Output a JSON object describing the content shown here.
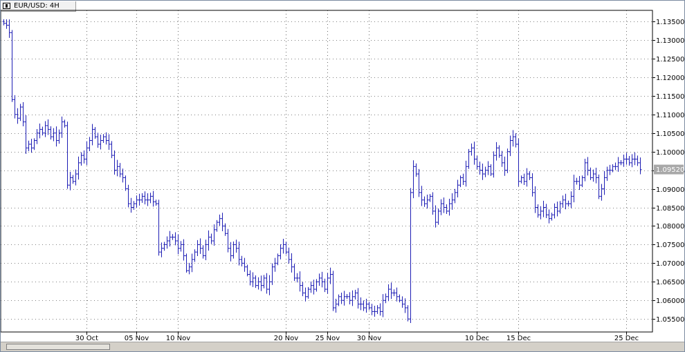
{
  "window": {
    "title": "EUR/USD: 4H"
  },
  "chart_data": {
    "type": "ohlc",
    "symbol": "EUR/USD",
    "timeframe": "4H",
    "current_price_label": "1.09520",
    "bar_color": "#1c1cb4",
    "grid": "dotted",
    "ylim": [
      1.0515,
      1.138
    ],
    "y_ticks": [
      "1.13500",
      "1.13000",
      "1.12500",
      "1.12000",
      "1.11500",
      "1.11000",
      "1.10500",
      "1.10000",
      "1.09500",
      "1.09000",
      "1.08500",
      "1.08000",
      "1.07500",
      "1.07000",
      "1.06500",
      "1.06000",
      "1.05500"
    ],
    "x_ticks": [
      {
        "label": "30 Oct",
        "bar": 30
      },
      {
        "label": "05 Nov",
        "bar": 48
      },
      {
        "label": "10 Nov",
        "bar": 63
      },
      {
        "label": "20 Nov",
        "bar": 102
      },
      {
        "label": "25 Nov",
        "bar": 117
      },
      {
        "label": "30 Nov",
        "bar": 132
      },
      {
        "label": "10 Dec",
        "bar": 171
      },
      {
        "label": "15 Dec",
        "bar": 186
      },
      {
        "label": "25 Dec",
        "bar": 225
      }
    ],
    "closes": [
      1.1345,
      1.134,
      1.132,
      1.114,
      1.11,
      1.109,
      1.112,
      1.108,
      1.101,
      1.102,
      1.101,
      1.103,
      1.105,
      1.106,
      1.105,
      1.107,
      1.106,
      1.104,
      1.105,
      1.103,
      1.105,
      1.108,
      1.107,
      1.091,
      1.093,
      1.092,
      1.094,
      1.097,
      1.099,
      1.098,
      1.101,
      1.103,
      1.106,
      1.104,
      1.102,
      1.103,
      1.104,
      1.103,
      1.102,
      1.099,
      1.095,
      1.096,
      1.094,
      1.093,
      1.09,
      1.086,
      1.085,
      1.086,
      1.087,
      1.087,
      1.088,
      1.087,
      1.087,
      1.088,
      1.0865,
      1.086,
      1.073,
      1.074,
      1.075,
      1.076,
      1.077,
      1.077,
      1.076,
      1.074,
      1.075,
      1.072,
      1.068,
      1.069,
      1.071,
      1.073,
      1.075,
      1.074,
      1.072,
      1.075,
      1.077,
      1.076,
      1.079,
      1.081,
      1.082,
      1.08,
      1.078,
      1.074,
      1.072,
      1.075,
      1.074,
      1.071,
      1.07,
      1.069,
      1.067,
      1.065,
      1.066,
      1.064,
      1.065,
      1.064,
      1.066,
      1.063,
      1.065,
      1.069,
      1.07,
      1.072,
      1.074,
      1.075,
      1.073,
      1.071,
      1.069,
      1.066,
      1.066,
      1.064,
      1.062,
      1.061,
      1.063,
      1.064,
      1.063,
      1.065,
      1.066,
      1.065,
      1.063,
      1.066,
      1.067,
      1.058,
      1.059,
      1.061,
      1.06,
      1.061,
      1.061,
      1.06,
      1.061,
      1.062,
      1.059,
      1.059,
      1.058,
      1.059,
      1.058,
      1.057,
      1.057,
      1.058,
      1.057,
      1.06,
      1.061,
      1.063,
      1.062,
      1.062,
      1.061,
      1.06,
      1.059,
      1.058,
      1.055,
      1.089,
      1.096,
      1.094,
      1.089,
      1.087,
      1.086,
      1.087,
      1.088,
      1.084,
      1.081,
      1.084,
      1.086,
      1.085,
      1.084,
      1.086,
      1.087,
      1.089,
      1.091,
      1.093,
      1.092,
      1.096,
      1.1,
      1.101,
      1.098,
      1.096,
      1.095,
      1.094,
      1.095,
      1.096,
      1.094,
      1.099,
      1.101,
      1.099,
      1.097,
      1.095,
      1.1,
      1.103,
      1.104,
      1.102,
      1.092,
      1.093,
      1.092,
      1.094,
      1.093,
      1.089,
      1.085,
      1.083,
      1.084,
      1.085,
      1.083,
      1.082,
      1.083,
      1.085,
      1.084,
      1.086,
      1.087,
      1.086,
      1.086,
      1.088,
      1.092,
      1.092,
      1.091,
      1.093,
      1.097,
      1.095,
      1.093,
      1.094,
      1.093,
      1.088,
      1.09,
      1.093,
      1.095,
      1.095,
      1.096,
      1.096,
      1.097,
      1.097,
      1.098,
      1.098,
      1.097,
      1.098,
      1.098,
      1.097,
      1.0952
    ]
  }
}
